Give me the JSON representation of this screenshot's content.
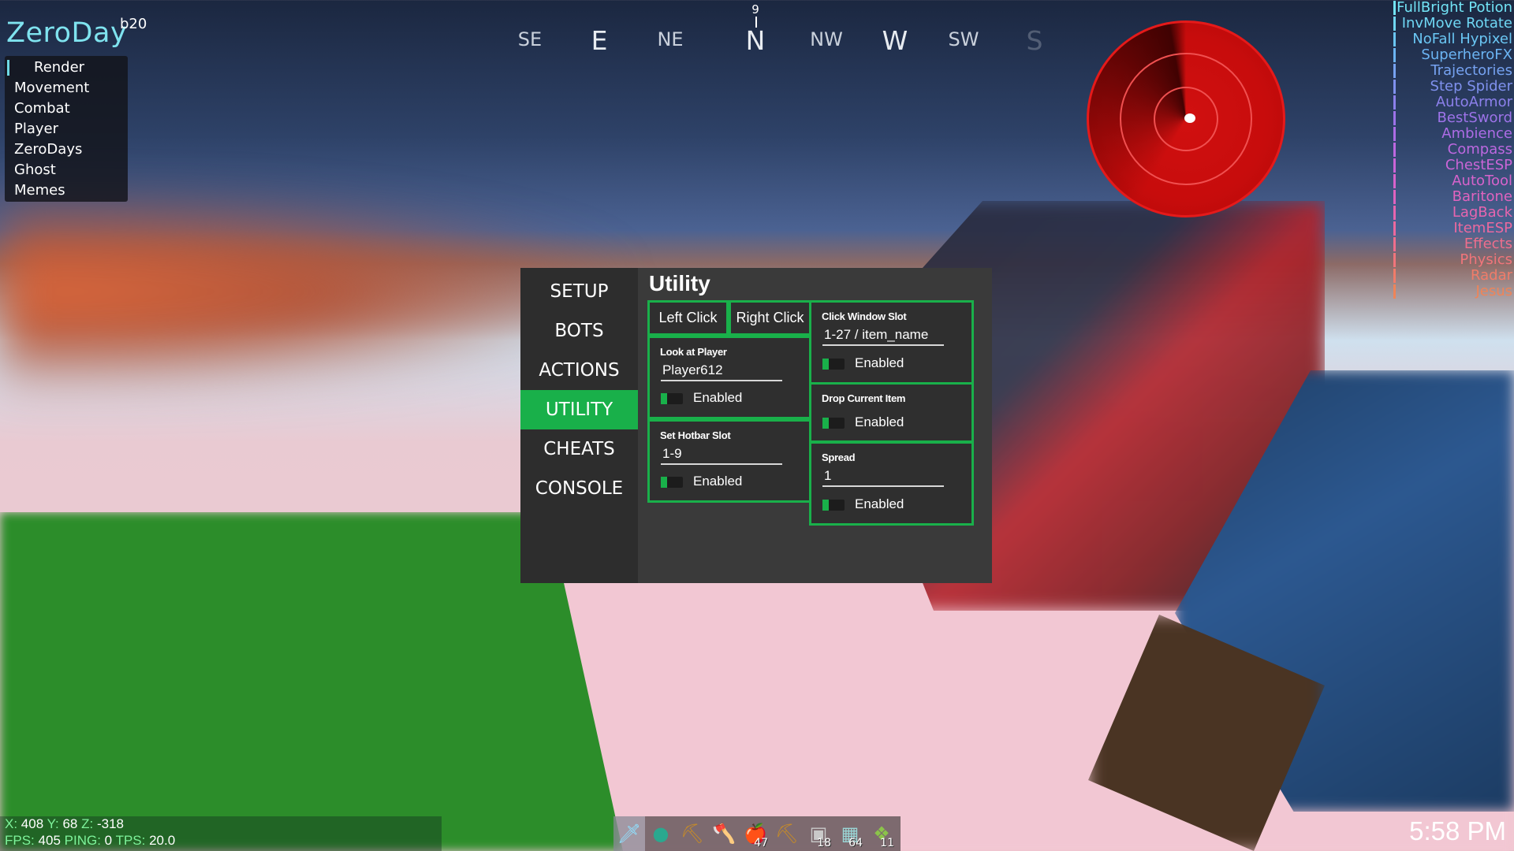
{
  "client": {
    "name": "ZeroDay",
    "build": "b20"
  },
  "categories": [
    "Render",
    "Movement",
    "Combat",
    "Player",
    "ZeroDays",
    "Ghost",
    "Memes"
  ],
  "compass": {
    "heading": "9",
    "directions": [
      {
        "label": "SE",
        "big": false,
        "faded": false
      },
      {
        "label": "E",
        "big": true,
        "faded": false
      },
      {
        "label": "NE",
        "big": false,
        "faded": false
      },
      {
        "label": "N",
        "big": true,
        "faded": false
      },
      {
        "label": "NW",
        "big": false,
        "faded": false
      },
      {
        "label": "W",
        "big": true,
        "faded": false
      },
      {
        "label": "SW",
        "big": false,
        "faded": false
      },
      {
        "label": "S",
        "big": true,
        "faded": true
      }
    ]
  },
  "modules": [
    {
      "label": "FullBright Potion",
      "color": "#72e4f6"
    },
    {
      "label": "InvMove Rotate",
      "color": "#6fd7f4"
    },
    {
      "label": "NoFall Hypixel",
      "color": "#6ac6f3"
    },
    {
      "label": "SuperheroFX",
      "color": "#6bb4f3"
    },
    {
      "label": "Trajectories",
      "color": "#76a2f1"
    },
    {
      "label": "Step Spider",
      "color": "#7f91ee"
    },
    {
      "label": "AutoArmor",
      "color": "#8c80ec"
    },
    {
      "label": "BestSword",
      "color": "#9d73e9"
    },
    {
      "label": "Ambience",
      "color": "#ad6ce6"
    },
    {
      "label": "Compass",
      "color": "#bd68e0"
    },
    {
      "label": "ChestESP",
      "color": "#cb65d7"
    },
    {
      "label": "AutoTool",
      "color": "#d763cc"
    },
    {
      "label": "Baritone",
      "color": "#e063bf"
    },
    {
      "label": "LagBack",
      "color": "#e765af"
    },
    {
      "label": "ItemESP",
      "color": "#ec699e"
    },
    {
      "label": "Effects",
      "color": "#ef6e8c"
    },
    {
      "label": "Physics",
      "color": "#f0757b"
    },
    {
      "label": "Radar",
      "color": "#f07c69"
    },
    {
      "label": "Jesus",
      "color": "#ef8458"
    }
  ],
  "panel": {
    "tabs": [
      "SETUP",
      "BOTS",
      "ACTIONS",
      "UTILITY",
      "CHEATS",
      "CONSOLE"
    ],
    "active_tab": "UTILITY",
    "title": "Utility",
    "buttons": {
      "left_click": "Left Click",
      "right_click": "Right Click"
    },
    "look_at_player": {
      "label": "Look at Player",
      "value": "Player612",
      "toggle": "Enabled"
    },
    "set_hotbar_slot": {
      "label": "Set Hotbar Slot",
      "value": "1-9",
      "toggle": "Enabled"
    },
    "click_window_slot": {
      "label": "Click Window Slot",
      "value": "1-27 / item_name",
      "toggle": "Enabled"
    },
    "drop_current_item": {
      "label": "Drop Current Item",
      "toggle": "Enabled"
    },
    "spread": {
      "label": "Spread",
      "value": "1",
      "toggle": "Enabled"
    },
    "accent_color": "#19b04a"
  },
  "info": {
    "x_label": "X:",
    "x": "408",
    "y_label": "Y:",
    "y": "68",
    "z_label": "Z:",
    "z": "-318",
    "fps_label": "FPS:",
    "fps": "405",
    "ping_label": "PING:",
    "ping": "0",
    "tps_label": "TPS:",
    "tps": "20.0"
  },
  "hotbar": [
    {
      "icon": "diamond-sword-icon",
      "glyph": "🗡",
      "count": "",
      "selected": true
    },
    {
      "icon": "ender-pearl-icon",
      "glyph": "●",
      "count": "",
      "selected": false
    },
    {
      "icon": "pickaxe-icon",
      "glyph": "⛏",
      "count": "",
      "selected": false
    },
    {
      "icon": "axe-icon",
      "glyph": "🪓",
      "count": "",
      "selected": false
    },
    {
      "icon": "golden-apple-icon",
      "glyph": "🍎",
      "count": "47",
      "selected": false
    },
    {
      "icon": "pickaxe-icon",
      "glyph": "⛏",
      "count": "",
      "selected": false
    },
    {
      "icon": "stone-block-icon",
      "glyph": "▣",
      "count": "18",
      "selected": false
    },
    {
      "icon": "glass-block-icon",
      "glyph": "▦",
      "count": "64",
      "selected": false
    },
    {
      "icon": "slime-block-icon",
      "glyph": "❖",
      "count": "11",
      "selected": false
    }
  ],
  "clock": "5:58 PM"
}
